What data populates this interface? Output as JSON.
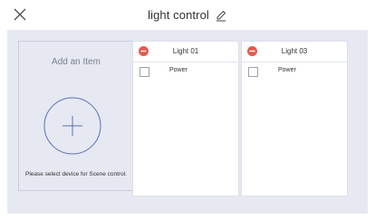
{
  "header": {
    "title": "light control",
    "close_icon": "close-icon",
    "edit_icon": "pencil-icon"
  },
  "add_item": {
    "title": "Add an Item",
    "hint": "Please select device for Scene control.",
    "icon": "plus-circle-icon"
  },
  "devices": [
    {
      "name": "Light 01",
      "rows": [
        {
          "label": "Power",
          "checked": false
        }
      ]
    },
    {
      "name": "Light 03",
      "rows": [
        {
          "label": "Power",
          "checked": false
        }
      ]
    }
  ],
  "colors": {
    "panel_bg": "#e6e9f1",
    "remove_red": "#e25b4e",
    "accent_blue": "#5a6fb8"
  }
}
